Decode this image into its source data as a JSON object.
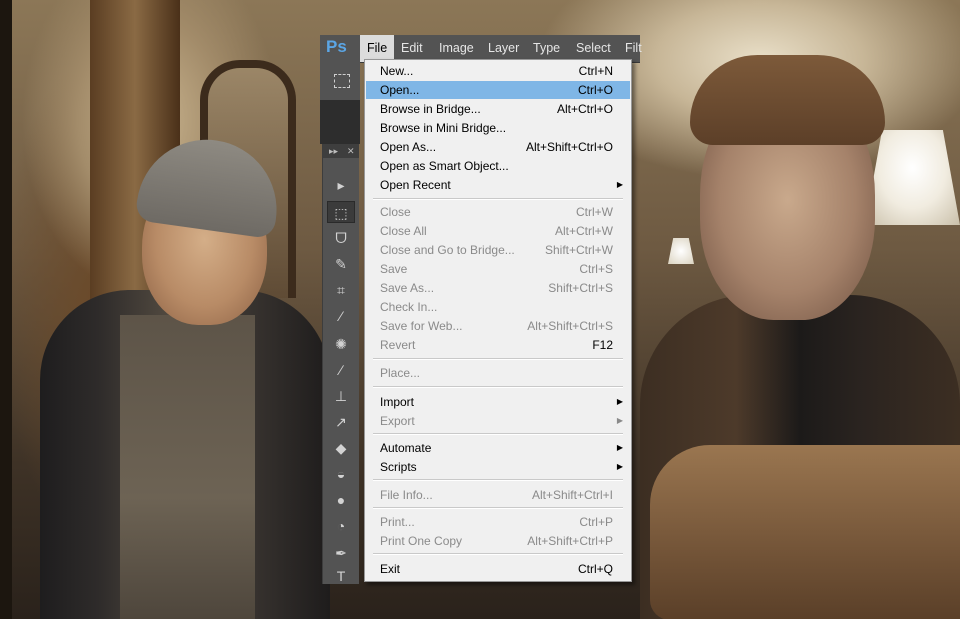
{
  "app": {
    "logo": "Ps",
    "menubar": [
      "File",
      "Edit",
      "Image",
      "Layer",
      "Type",
      "Select",
      "Filt"
    ],
    "active_menu": "File",
    "accent": "#5ba6e6",
    "highlight": "#7fb6e6"
  },
  "toolbox": {
    "collapse_label": "▸▸",
    "close_label": "✕",
    "tools": [
      {
        "name": "move-tool-icon",
        "glyph": "▸"
      },
      {
        "name": "rectangular-marquee-tool-icon",
        "glyph": "⬚"
      },
      {
        "name": "lasso-tool-icon",
        "glyph": "ᗜ"
      },
      {
        "name": "quick-selection-tool-icon",
        "glyph": "✎"
      },
      {
        "name": "crop-tool-icon",
        "glyph": "⌗"
      },
      {
        "name": "eyedropper-tool-icon",
        "glyph": "⁄"
      },
      {
        "name": "spot-healing-brush-tool-icon",
        "glyph": "✺"
      },
      {
        "name": "brush-tool-icon",
        "glyph": "∕"
      },
      {
        "name": "clone-stamp-tool-icon",
        "glyph": "⊥"
      },
      {
        "name": "history-brush-tool-icon",
        "glyph": "↗"
      },
      {
        "name": "eraser-tool-icon",
        "glyph": "◆"
      },
      {
        "name": "paint-bucket-tool-icon",
        "glyph": "◒"
      },
      {
        "name": "blur-tool-icon",
        "glyph": "●"
      },
      {
        "name": "dodge-tool-icon",
        "glyph": "◔"
      },
      {
        "name": "pen-tool-icon",
        "glyph": "✒"
      },
      {
        "name": "type-tool-icon",
        "glyph": "T"
      }
    ]
  },
  "file_menu": {
    "items": [
      {
        "label": "New...",
        "shortcut": "Ctrl+N",
        "disabled": false
      },
      {
        "label": "Open...",
        "shortcut": "Ctrl+O",
        "disabled": false,
        "highlighted": true
      },
      {
        "label": "Browse in Bridge...",
        "shortcut": "Alt+Ctrl+O",
        "disabled": false
      },
      {
        "label": "Browse in Mini Bridge...",
        "shortcut": "",
        "disabled": false
      },
      {
        "label": "Open As...",
        "shortcut": "Alt+Shift+Ctrl+O",
        "disabled": false
      },
      {
        "label": "Open as Smart Object...",
        "shortcut": "",
        "disabled": false
      },
      {
        "label": "Open Recent",
        "shortcut": "",
        "disabled": false,
        "submenu": true
      },
      {
        "label": "Close",
        "shortcut": "Ctrl+W",
        "disabled": true
      },
      {
        "label": "Close All",
        "shortcut": "Alt+Ctrl+W",
        "disabled": true
      },
      {
        "label": "Close and Go to Bridge...",
        "shortcut": "Shift+Ctrl+W",
        "disabled": true
      },
      {
        "label": "Save",
        "shortcut": "Ctrl+S",
        "disabled": true
      },
      {
        "label": "Save As...",
        "shortcut": "Shift+Ctrl+S",
        "disabled": true
      },
      {
        "label": "Check In...",
        "shortcut": "",
        "disabled": true
      },
      {
        "label": "Save for Web...",
        "shortcut": "Alt+Shift+Ctrl+S",
        "disabled": true
      },
      {
        "label": "Revert",
        "shortcut": "F12",
        "disabled": true
      },
      {
        "label": "Place...",
        "shortcut": "",
        "disabled": true
      },
      {
        "label": "Import",
        "shortcut": "",
        "disabled": false,
        "submenu": true
      },
      {
        "label": "Export",
        "shortcut": "",
        "disabled": true,
        "submenu": true
      },
      {
        "label": "Automate",
        "shortcut": "",
        "disabled": false,
        "submenu": true
      },
      {
        "label": "Scripts",
        "shortcut": "",
        "disabled": false,
        "submenu": true
      },
      {
        "label": "File Info...",
        "shortcut": "Alt+Shift+Ctrl+I",
        "disabled": true
      },
      {
        "label": "Print...",
        "shortcut": "Ctrl+P",
        "disabled": true
      },
      {
        "label": "Print One Copy",
        "shortcut": "Alt+Shift+Ctrl+P",
        "disabled": true
      },
      {
        "label": "Exit",
        "shortcut": "Ctrl+Q",
        "disabled": false
      }
    ]
  }
}
